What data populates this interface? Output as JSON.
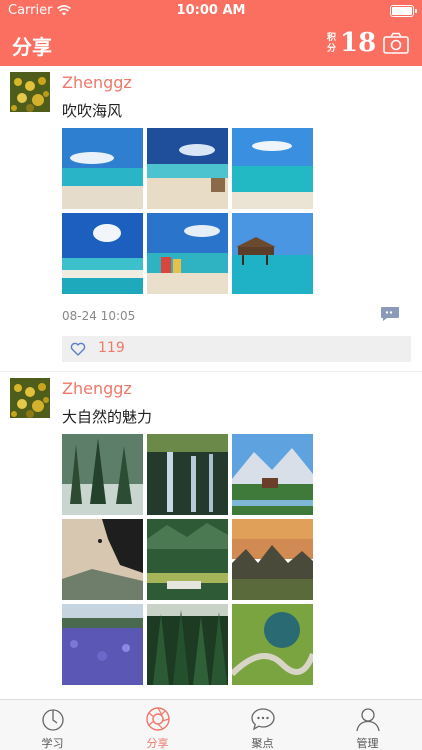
{
  "status_bar": {
    "carrier": "Carrier",
    "time": "10:00 AM"
  },
  "nav": {
    "title": "分享",
    "score_label": "积分",
    "score_value": "18",
    "camera_icon": "camera-icon"
  },
  "colors": {
    "accent": "#fb6f61",
    "link": "#f0786a",
    "likes_bg": "#efefef",
    "tab_active": "#f0786a"
  },
  "posts": [
    {
      "username": "Zhenggz",
      "text": "吹吹海风",
      "images": [
        "beach-photo",
        "beach-photo",
        "beach-photo",
        "beach-photo",
        "beach-photo",
        "beach-photo"
      ],
      "time": "08-24 10:05",
      "likes": "119"
    },
    {
      "username": "Zhenggz",
      "text": "大自然的魅力",
      "images": [
        "forest-photo",
        "waterfall-photo",
        "mountain-village-photo",
        "cliff-climber-photo",
        "valley-photo",
        "sunset-hills-photo",
        "lavender-field-photo",
        "pine-forest-photo",
        "winding-road-photo"
      ]
    }
  ],
  "tabs": [
    {
      "label": "学习",
      "icon": "clock-icon"
    },
    {
      "label": "分享",
      "icon": "aperture-icon",
      "active": true
    },
    {
      "label": "聚点",
      "icon": "chat-bubble-icon"
    },
    {
      "label": "管理",
      "icon": "person-icon"
    }
  ]
}
